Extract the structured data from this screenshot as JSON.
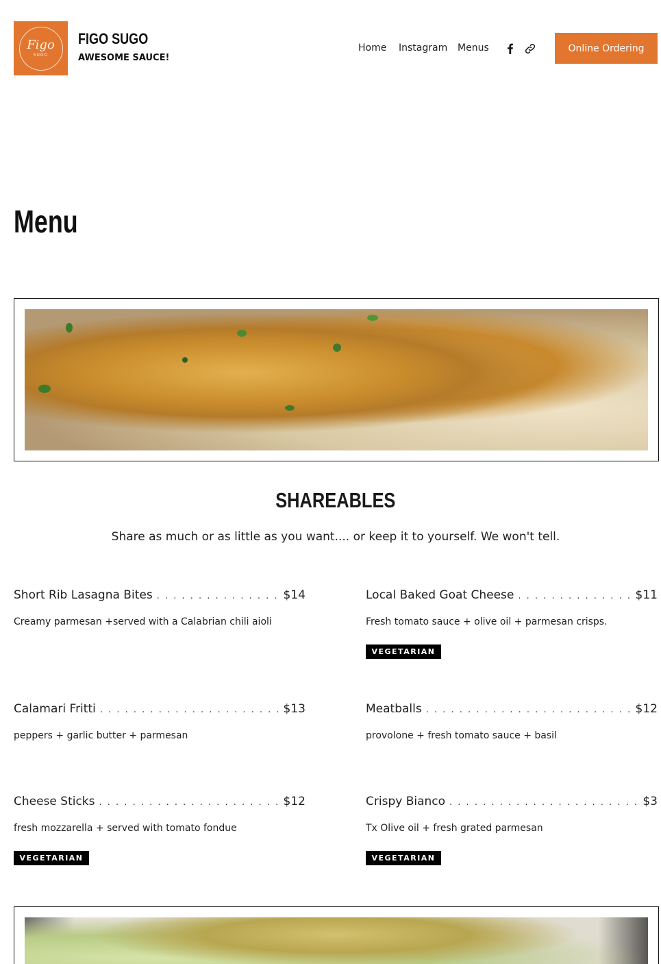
{
  "header": {
    "logo_text": "Figo",
    "logo_sub": "SUGO",
    "brand_name": "FIGO SUGO",
    "tagline": "AWESOME SAUCE!",
    "nav": [
      "Home",
      "Instagram",
      "Menus"
    ],
    "social_icons": [
      "facebook-icon",
      "link-icon"
    ],
    "order_label": "Online Ordering",
    "accent_color": "#e2762f"
  },
  "page": {
    "title": "Menu"
  },
  "section": {
    "title": "SHAREABLES",
    "subtitle": "Share as much or as little as you want.... or keep it to yourself. We won't tell."
  },
  "items": [
    {
      "name": "Short Rib Lasagna Bites",
      "price": "$14",
      "desc": "Creamy parmesan +served with a Calabrian chili aioli",
      "badge": ""
    },
    {
      "name": "Local Baked Goat Cheese",
      "price": "$11",
      "desc": "Fresh tomato sauce + olive oil + parmesan crisps.",
      "badge": "VEGETARIAN"
    },
    {
      "name": "Calamari Fritti",
      "price": "$13",
      "desc": "peppers + garlic butter + parmesan",
      "badge": ""
    },
    {
      "name": "Meatballs",
      "price": "$12",
      "desc": "provolone + fresh tomato sauce + basil",
      "badge": ""
    },
    {
      "name": "Cheese Sticks",
      "price": "$12",
      "desc": "fresh mozzarella + served with tomato fondue",
      "badge": "VEGETARIAN"
    },
    {
      "name": "Crispy Bianco",
      "price": "$3",
      "desc": "Tx Olive oil + fresh grated parmesan",
      "badge": "VEGETARIAN"
    }
  ]
}
